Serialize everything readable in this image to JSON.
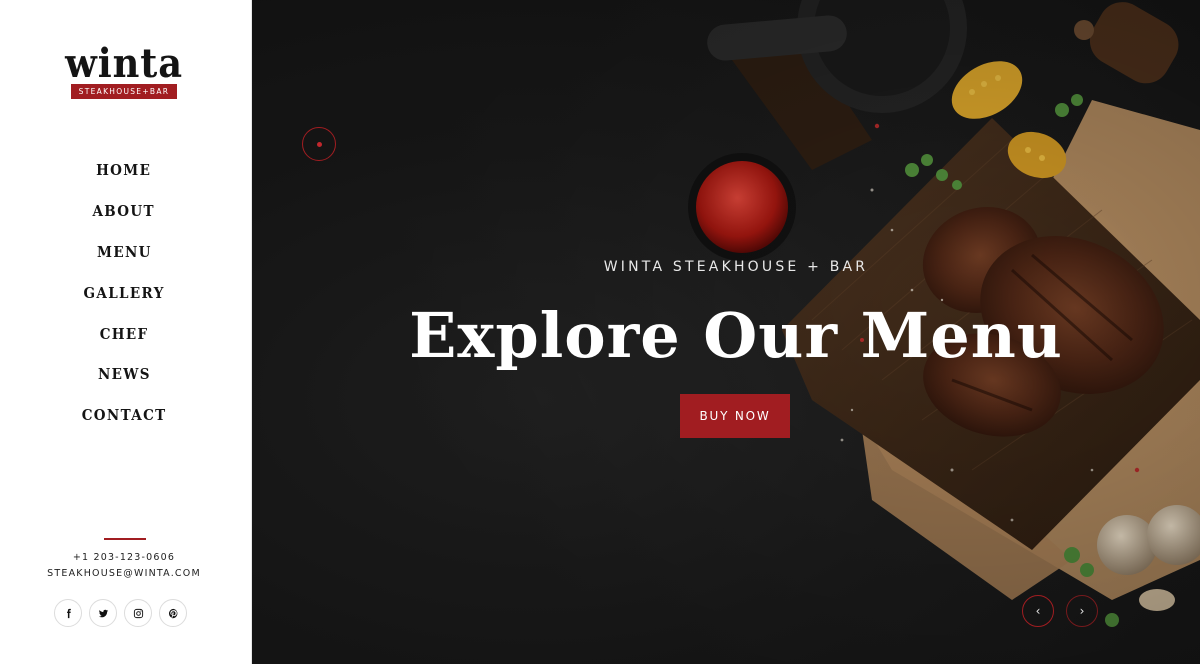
{
  "brand": {
    "name": "winta",
    "tagline": "STEAKHOUSE+BAR",
    "accent_color": "#a11d21"
  },
  "nav": {
    "items": [
      {
        "label": "HOME"
      },
      {
        "label": "ABOUT"
      },
      {
        "label": "MENU"
      },
      {
        "label": "GALLERY"
      },
      {
        "label": "CHEF"
      },
      {
        "label": "NEWS"
      },
      {
        "label": "CONTACT"
      }
    ]
  },
  "contact": {
    "phone": "+1 203-123-0606",
    "email": "STEAKHOUSE@WINTA.COM"
  },
  "socials": [
    {
      "icon": "facebook-icon"
    },
    {
      "icon": "twitter-icon"
    },
    {
      "icon": "instagram-icon"
    },
    {
      "icon": "pinterest-icon"
    }
  ],
  "hero": {
    "eyebrow": "WINTA STEAKHOUSE + BAR",
    "headline": "Explore Our Menu",
    "cta_label": "BUY NOW",
    "prev_arrow": "‹",
    "next_arrow": "›"
  }
}
